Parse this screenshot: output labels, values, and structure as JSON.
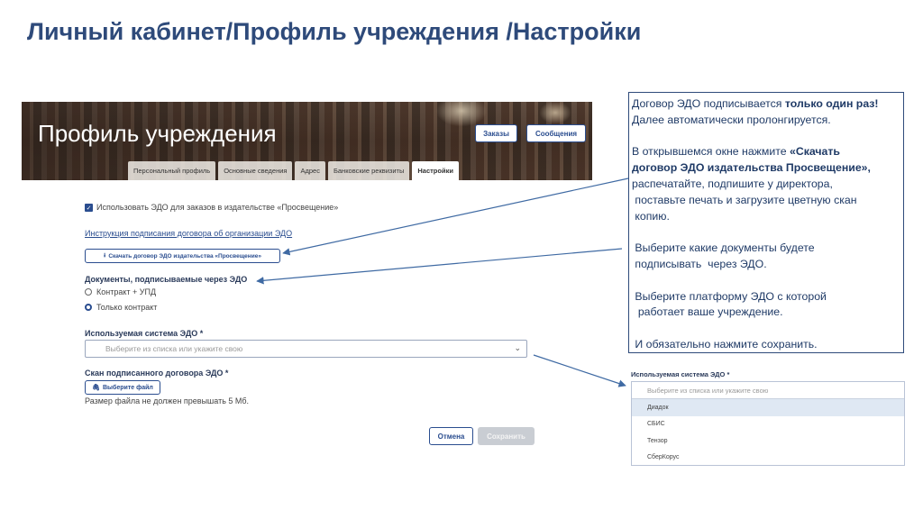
{
  "slide": {
    "title": "Личный кабинет/Профиль учреждения /Настройки"
  },
  "banner": {
    "title": "Профиль учреждения",
    "orders_label": "Заказы",
    "messages_label": "Сообщения",
    "tabs": [
      {
        "label": "Персональный профиль",
        "active": false
      },
      {
        "label": "Основные сведения",
        "active": false
      },
      {
        "label": "Адрес",
        "active": false
      },
      {
        "label": "Банковские реквизиты",
        "active": false
      },
      {
        "label": "Настройки",
        "active": true
      }
    ]
  },
  "form": {
    "use_edo_checkbox_label": "Использовать ЭДО для заказов в издательстве «Просвещение»",
    "instruction_link": "Инструкция подписания договора об организации ЭДО",
    "download_button": "Скачать договор ЭДО издательства «Просвещение»",
    "documents_label": "Документы, подписываемые через ЭДО",
    "radio_options": [
      {
        "label": "Контракт + УПД",
        "selected": false
      },
      {
        "label": "Только контракт",
        "selected": true
      }
    ],
    "system_label": "Используемая система ЭДО *",
    "system_placeholder": "Выберите из списка или укажите свою",
    "scan_label": "Скан подписанного договора ЭДО *",
    "file_button": "Выберите файл",
    "file_hint": "Размер файла не должен превышать 5 Мб.",
    "cancel_button": "Отмена",
    "save_button": "Сохранить"
  },
  "info": {
    "line1_pre": "Договор ЭДО подписывается ",
    "line1_bold": "только один раз!",
    "line2": "Далее автоматически пролонгируется.",
    "line3_pre": "В открывшемся окне нажмите ",
    "line3_bold": "«Скачать",
    "line4_bold": "договор ЭДО издательства Просвещение»,",
    "line5": "распечатайте, подпишите у директора,",
    "line6": " поставьте печать и загрузите цветную скан",
    "line7": " копию.",
    "line8": " Выберите какие документы будете",
    "line9": " подписывать  через ЭДО.",
    "line10": " Выберите платформу ЭДО с которой",
    "line11": "  работает ваше учреждение.",
    "line12": " И обязательно нажмите сохранить."
  },
  "dropdown": {
    "label": "Используемая система ЭДО *",
    "placeholder": "Выберите из списка или укажите свою",
    "options": [
      "Диадок",
      "СБИС",
      "Тензор",
      "СберКорус"
    ],
    "highlighted_index": 0
  },
  "colors": {
    "accent": "#2a4d8f",
    "title": "#2e4a7a",
    "arrow": "#3f6aa3"
  }
}
